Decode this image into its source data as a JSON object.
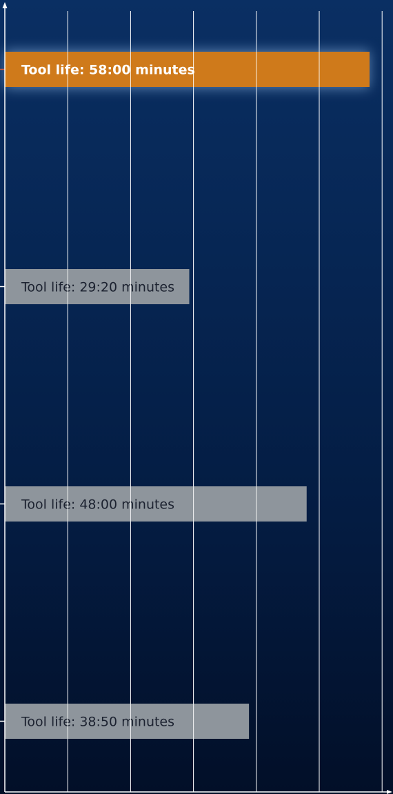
{
  "chart_data": {
    "type": "bar",
    "orientation": "horizontal",
    "title": "",
    "xlabel": "",
    "ylabel": "",
    "unit": "minutes",
    "x_axis_arrow": true,
    "y_axis_arrow": true,
    "grid": true,
    "xlim": [
      0,
      62
    ],
    "bars": [
      {
        "label": "Tool life: 58:00 minutes",
        "value": 58.0,
        "highlight": true,
        "color": "#cf7a1b",
        "text_color": "#ffffff",
        "tick_color": "#d95b3a"
      },
      {
        "label": "Tool life: 29:20 minutes",
        "value": 29.33,
        "highlight": false,
        "color": "#8e959c",
        "text_color": "#1c2230",
        "tick_color": "#ffffff"
      },
      {
        "label": "Tool life: 48:00 minutes",
        "value": 48.0,
        "highlight": false,
        "color": "#8e959c",
        "text_color": "#1c2230",
        "tick_color": "#ffffff"
      },
      {
        "label": "Tool life: 38:50 minutes",
        "value": 38.83,
        "highlight": false,
        "color": "#8e959c",
        "text_color": "#1c2230",
        "tick_color": "#ffffff"
      }
    ]
  }
}
